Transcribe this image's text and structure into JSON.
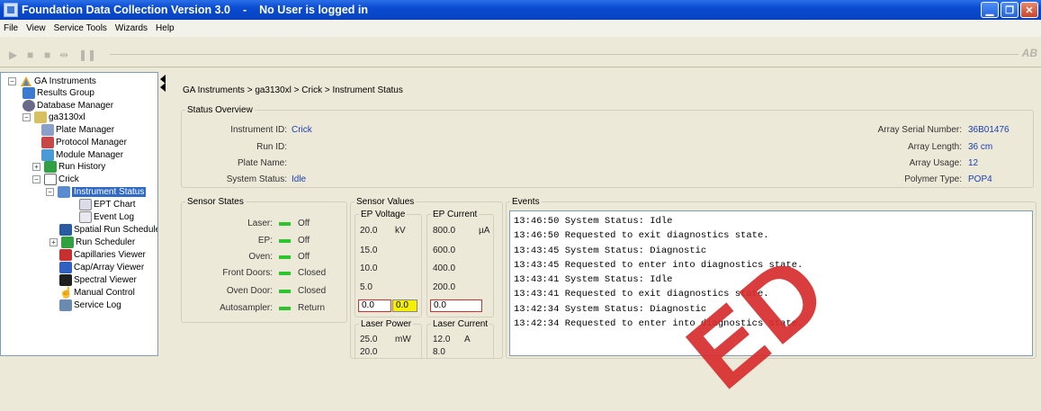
{
  "window": {
    "title": "Foundation Data Collection Version 3.0",
    "separator": "-",
    "user_status": "No User is logged in"
  },
  "menu": [
    "File",
    "View",
    "Service Tools",
    "Wizards",
    "Help"
  ],
  "toolbar": {
    "logo": "AB"
  },
  "tree": {
    "root": "GA Instruments",
    "results_group": "Results Group",
    "database_manager": "Database Manager",
    "instrument": "ga3130xl",
    "plate_manager": "Plate Manager",
    "protocol_manager": "Protocol Manager",
    "module_manager": "Module Manager",
    "run_history": "Run History",
    "crick": "Crick",
    "instrument_status": "Instrument Status",
    "ept_chart": "EPT Chart",
    "event_log": "Event Log",
    "spatial_run_scheduler": "Spatial Run Schedule",
    "run_scheduler": "Run Scheduler",
    "capillaries_viewer": "Capillaries Viewer",
    "cap_array_viewer": "Cap/Array Viewer",
    "spectral_viewer": "Spectral Viewer",
    "manual_control": "Manual Control",
    "service_log": "Service Log"
  },
  "breadcrumb": "GA Instruments > ga3130xl > Crick > Instrument Status",
  "status_overview": {
    "legend": "Status Overview",
    "instrument_id_label": "Instrument ID:",
    "instrument_id": "Crick",
    "run_id_label": "Run ID:",
    "run_id": "",
    "plate_name_label": "Plate Name:",
    "plate_name": "",
    "system_status_label": "System Status:",
    "system_status": "Idle",
    "array_serial_label": "Array Serial Number:",
    "array_serial": "36B01476",
    "array_length_label": "Array Length:",
    "array_length": "36 cm",
    "array_usage_label": "Array Usage:",
    "array_usage": "12",
    "polymer_type_label": "Polymer Type:",
    "polymer_type": "POP4"
  },
  "sensor_states": {
    "legend": "Sensor States",
    "items": [
      {
        "label": "Laser:",
        "value": "Off"
      },
      {
        "label": "EP:",
        "value": "Off"
      },
      {
        "label": "Oven:",
        "value": "Off"
      },
      {
        "label": "Front Doors:",
        "value": "Closed"
      },
      {
        "label": "Oven Door:",
        "value": "Closed"
      },
      {
        "label": "Autosampler:",
        "value": "Return"
      }
    ],
    "led_color": "#2ec42e"
  },
  "sensor_values": {
    "legend": "Sensor Values",
    "ep_voltage": {
      "title": "EP Voltage",
      "unit": "kV",
      "ticks": [
        "20.0",
        "15.0",
        "10.0",
        "5.0"
      ],
      "value": "0.0",
      "target": "0.0"
    },
    "ep_current": {
      "title": "EP Current",
      "unit": "µA",
      "ticks": [
        "800.0",
        "600.0",
        "400.0",
        "200.0"
      ],
      "value": "0.0"
    },
    "laser_power": {
      "title": "Laser Power",
      "unit": "mW",
      "ticks": [
        "25.0",
        "20.0"
      ]
    },
    "laser_current": {
      "title": "Laser Current",
      "unit": "A",
      "ticks": [
        "12.0",
        "8.0"
      ]
    }
  },
  "events": {
    "legend": "Events",
    "lines": [
      "13:46:50 System Status: Idle",
      "13:46:50 Requested to exit diagnostics state.",
      "13:43:45 System Status: Diagnostic",
      "13:43:45 Requested to enter into diagnostics state.",
      "13:43:41 System Status: Idle",
      "13:43:41 Requested to exit diagnostics state.",
      "13:42:34 System Status: Diagnostic",
      "13:42:34 Requested to enter into diagnostics state."
    ]
  },
  "watermark": "ED",
  "colors": {
    "accent": "#1a3fb0",
    "selection": "#316ac5",
    "watermark": "#d72d2d"
  }
}
